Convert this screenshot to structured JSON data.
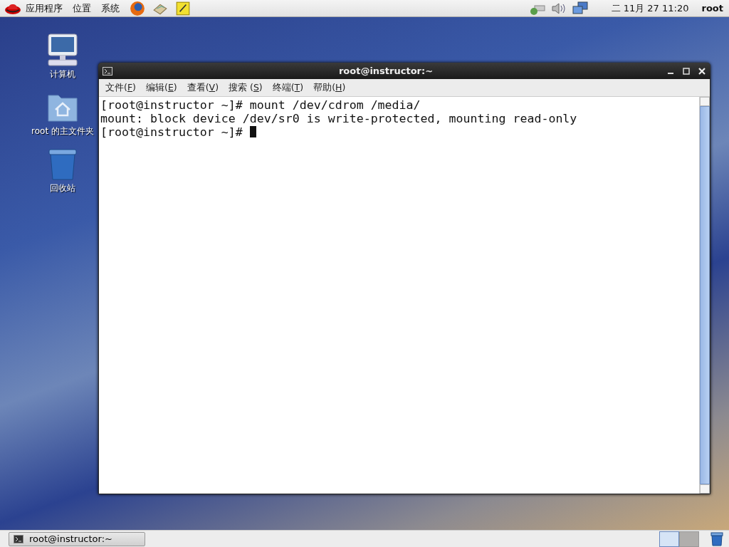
{
  "top_panel": {
    "menus": [
      "应用程序",
      "位置",
      "系统"
    ],
    "clock": "二 11月 27 11:20",
    "user": "root"
  },
  "desktop_icons": [
    {
      "kind": "computer",
      "label": "计算机"
    },
    {
      "kind": "home",
      "label": "root 的主文件夹"
    },
    {
      "kind": "trash",
      "label": "回收站"
    }
  ],
  "window": {
    "title": "root@instructor:~",
    "menu": [
      {
        "text": "文件(",
        "key": "F",
        "after": ")"
      },
      {
        "text": "编辑(",
        "key": "E",
        "after": ")"
      },
      {
        "text": "查看(",
        "key": "V",
        "after": ")"
      },
      {
        "text": "搜索 (",
        "key": "S",
        "after": ")"
      },
      {
        "text": "终端(",
        "key": "T",
        "after": ")"
      },
      {
        "text": "帮助(",
        "key": "H",
        "after": ")"
      }
    ],
    "lines": [
      {
        "text": "[root@instructor ~]# mount /dev/cdrom /media/",
        "cursor": false
      },
      {
        "text": "mount: block device /dev/sr0 is write-protected, mounting read-only",
        "cursor": false
      },
      {
        "text": "[root@instructor ~]# ",
        "cursor": true
      }
    ]
  },
  "taskbar": {
    "tasks": [
      {
        "label": "root@instructor:~"
      }
    ],
    "workspaces": [
      {
        "selected": true
      },
      {
        "selected": false
      }
    ]
  }
}
